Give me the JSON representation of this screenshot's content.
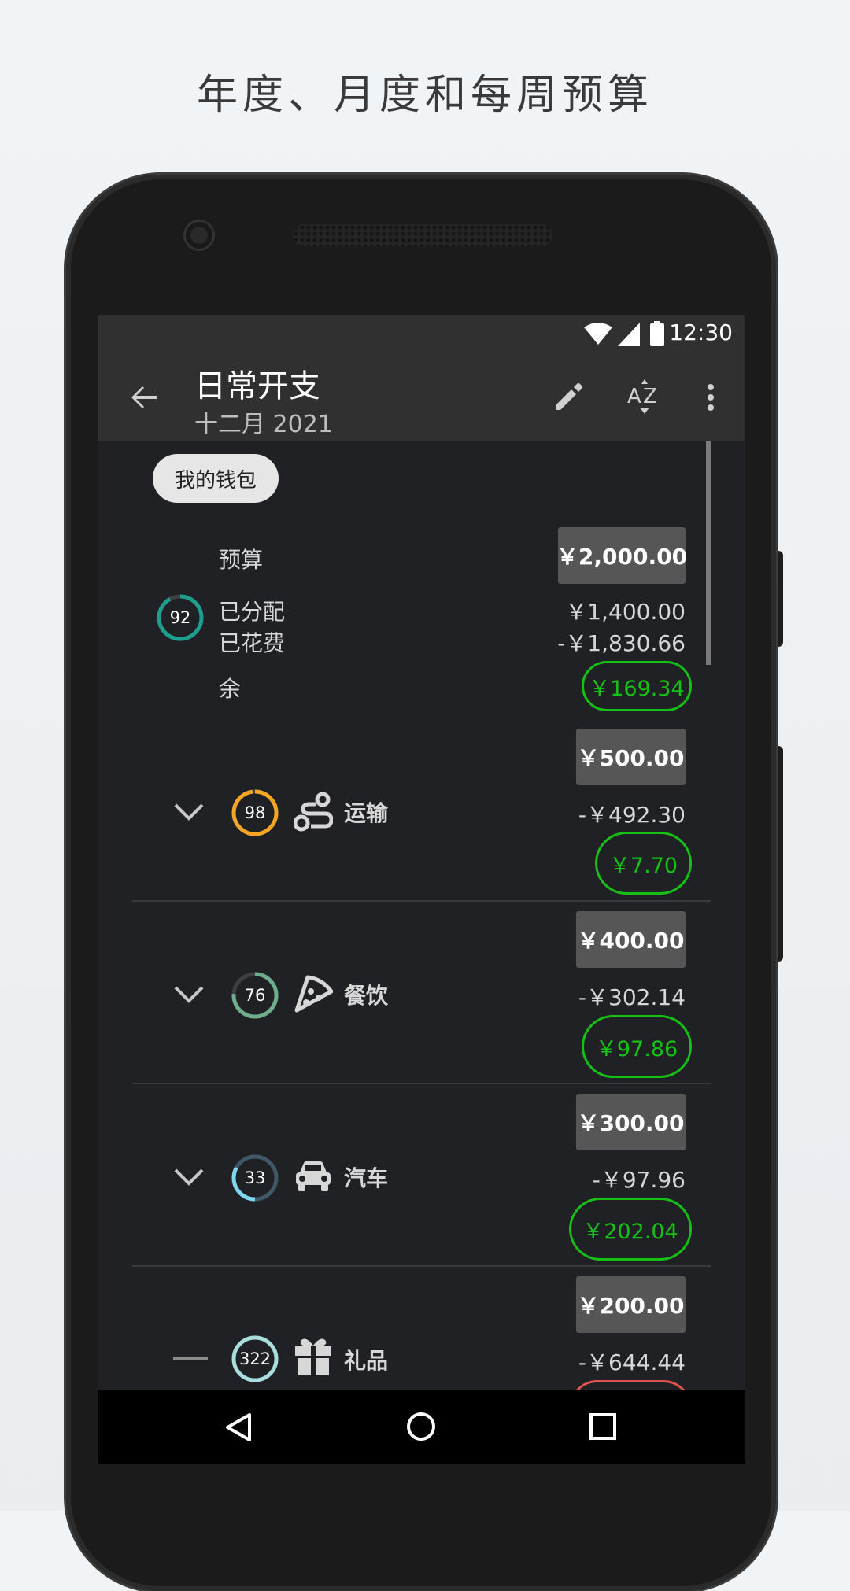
{
  "headline": "年度、月度和每周预算",
  "status": {
    "time": "12:30"
  },
  "appbar": {
    "title": "日常开支",
    "subtitle": "十二月 2021"
  },
  "chip": "我的钱包",
  "summary": {
    "budget_label": "预算",
    "budget_value": "￥2,000.00",
    "progress": "92",
    "allocated_label": "已分配",
    "allocated_value": "￥1,400.00",
    "spent_label": "已花费",
    "spent_value": "-￥1,830.66",
    "remaining_label": "余",
    "remaining_value": "￥169.34"
  },
  "categories": [
    {
      "name": "运输",
      "progress": "98",
      "budget": "￥500.00",
      "spent": "-￥492.30",
      "remaining": "￥7.70",
      "ring_color": "#f5a623",
      "ring_fraction": 0.98
    },
    {
      "name": "餐饮",
      "progress": "76",
      "budget": "￥400.00",
      "spent": "-￥302.14",
      "remaining": "￥97.86",
      "ring_color": "#6fae8c",
      "ring_fraction": 0.76
    },
    {
      "name": "汽车",
      "progress": "33",
      "budget": "￥300.00",
      "spent": "-￥97.96",
      "remaining": "￥202.04",
      "ring_color": "#7fd6f0",
      "ring_fraction": 0.33
    },
    {
      "name": "礼品",
      "progress": "322",
      "budget": "￥200.00",
      "spent": "-￥644.44",
      "remaining": "",
      "ring_color": "#a8dede",
      "ring_fraction": 1.0
    }
  ],
  "colors": {
    "accent_green": "#16c116",
    "overspent_red": "#e0524d",
    "screen_bg": "#202124",
    "appbar_bg": "#303030"
  }
}
